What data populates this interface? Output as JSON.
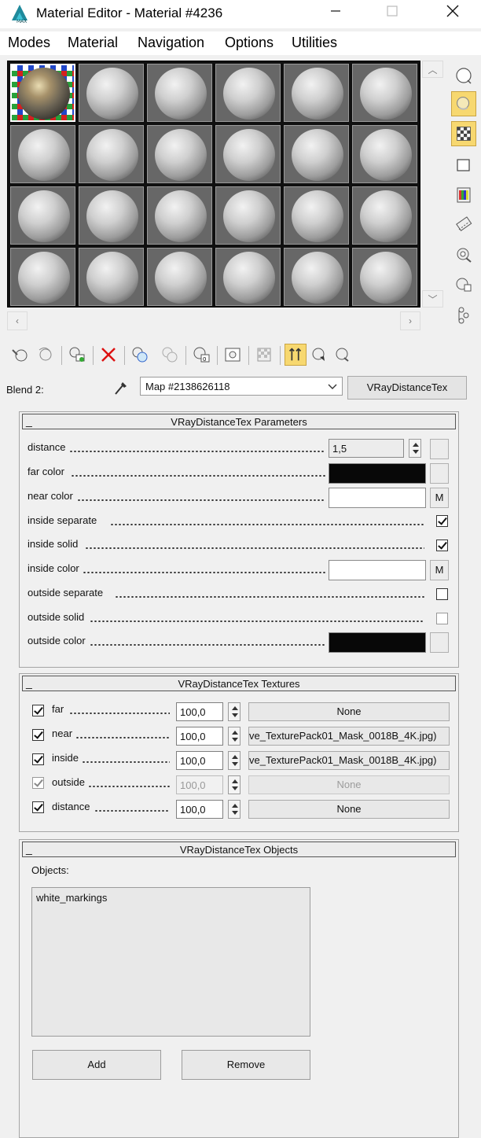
{
  "window": {
    "title": "Material Editor - Material #4236",
    "controls": [
      "minimize-icon",
      "maximize-icon",
      "close-icon"
    ]
  },
  "menu": [
    "Modes",
    "Material",
    "Navigation",
    "Options",
    "Utilities"
  ],
  "sample_slots": {
    "rows": 4,
    "columns": 6,
    "active_slot": 1
  },
  "right_toolbar": {
    "icons": [
      "sample-type-icon",
      "backlight-icon",
      "background-icon",
      "sample-uv-tiling-icon",
      "video-color-check-icon",
      "make-preview-icon",
      "options-icon",
      "select-by-material-icon",
      "material-map-navigator-icon"
    ],
    "active": [
      "backlight-icon",
      "background-icon"
    ]
  },
  "main_toolbar": {
    "icons": [
      "get-material-icon",
      "put-to-scene-icon",
      "assign-to-selection-icon",
      "reset-map-icon",
      "make-unique-icon",
      "put-to-library-icon",
      "material-id-channel-icon",
      "show-shaded-in-viewport-icon",
      "show-end-result-icon",
      "go-to-parent-icon",
      "go-forward-to-sibling-icon"
    ],
    "active": [
      "go-to-parent-icon"
    ]
  },
  "map_row": {
    "label": "Blend 2:",
    "map_name": "Map #2138626118",
    "map_type": "VRayDistanceTex"
  },
  "parameters": {
    "title": "VRayDistanceTex Parameters",
    "collapse": "_",
    "distance_label": "distance",
    "distance_value": "1,5",
    "far_color_label": "far color",
    "near_color_label": "near color",
    "inside_separate_label": "inside separate",
    "inside_solid_label": "inside solid",
    "inside_color_label": "inside color",
    "outside_separate_label": "outside separate",
    "outside_solid_label": "outside solid",
    "outside_color_label": "outside color",
    "map_button": "M",
    "far_color": "#080808",
    "near_color": "#ffffff",
    "inside_color": "#ffffff",
    "outside_color": "#080808",
    "inside_separate": true,
    "inside_solid": true,
    "outside_separate": false,
    "outside_solid": false
  },
  "textures": {
    "title": "VRayDistanceTex Textures",
    "collapse": "_",
    "rows": [
      {
        "label": "far",
        "checked": true,
        "amount": "100,0",
        "map": "None",
        "enabled": true
      },
      {
        "label": "near",
        "checked": true,
        "amount": "100,0",
        "map": "ve_TexturePack01_Mask_0018B_4K.jpg)",
        "enabled": true
      },
      {
        "label": "inside",
        "checked": true,
        "amount": "100,0",
        "map": "ve_TexturePack01_Mask_0018B_4K.jpg)",
        "enabled": true
      },
      {
        "label": "outside",
        "checked": true,
        "amount": "100,0",
        "map": "None",
        "enabled": false
      },
      {
        "label": "distance",
        "checked": true,
        "amount": "100,0",
        "map": "None",
        "enabled": true
      }
    ]
  },
  "objects": {
    "title": "VRayDistanceTex Objects",
    "collapse": "_",
    "label": "Objects:",
    "items": [
      "white_markings"
    ],
    "add_label": "Add",
    "remove_label": "Remove"
  }
}
